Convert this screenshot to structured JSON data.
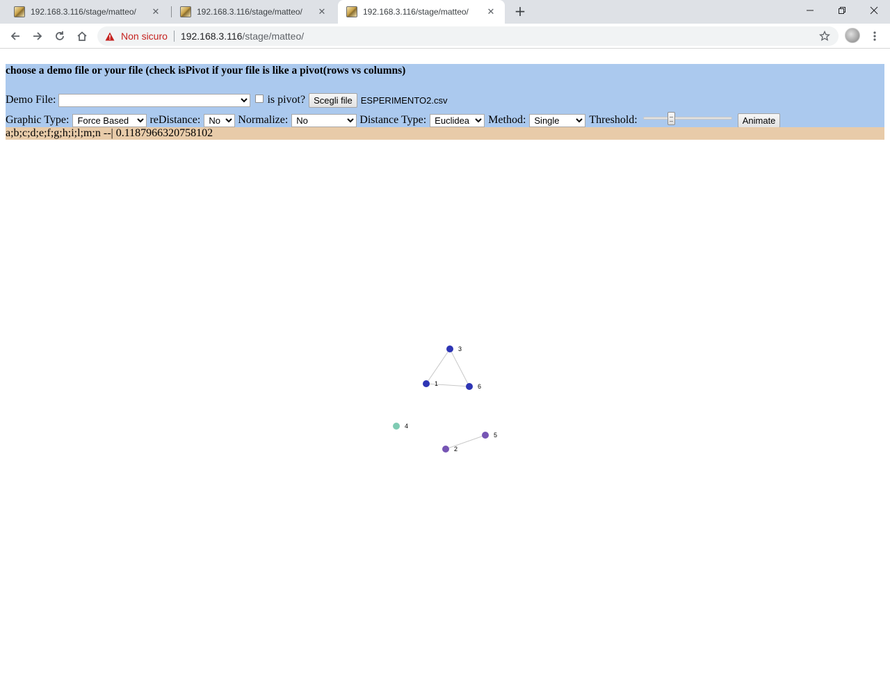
{
  "browser": {
    "tabs": [
      {
        "title": "192.168.3.116/stage/matteo/",
        "active": false
      },
      {
        "title": "192.168.3.116/stage/matteo/",
        "active": false
      },
      {
        "title": "192.168.3.116/stage/matteo/",
        "active": true
      }
    ],
    "security_text": "Non sicuro",
    "url_host": "192.168.3.116",
    "url_path": "/stage/matteo/",
    "icons": {
      "favicon": "image-favicon-icon",
      "close": "close-icon",
      "new_tab": "plus-icon",
      "back": "arrow-left-icon",
      "forward": "arrow-right-icon",
      "reload": "reload-icon",
      "home": "home-icon",
      "warning": "warning-triangle-icon",
      "bookmark": "star-icon",
      "menu": "kebab-menu-icon"
    }
  },
  "page": {
    "heading": "choose a demo file or your file (check isPivot if your file is like a pivot(rows vs columns)",
    "demo_file_label": "Demo File:",
    "demo_file_value": "",
    "is_pivot_label": "is pivot?",
    "is_pivot_checked": false,
    "choose_file_button": "Scegli file",
    "chosen_file_name": "ESPERIMENTO2.csv",
    "graphic_type_label": "Graphic Type:",
    "graphic_type_value": "Force Based",
    "redistance_label": "reDistance:",
    "redistance_value": "No",
    "normalize_label": "Normalize:",
    "normalize_value": "No",
    "distance_type_label": "Distance Type:",
    "distance_type_value": "Euclidea",
    "method_label": "Method:",
    "method_value": "Single",
    "threshold_label": "Threshold:",
    "threshold_level": 0.3,
    "animate_button": "Animate",
    "result_text": "a;b;c;d;e;f;g;h;i;l;m;n --| 0.1187966320758102",
    "colors": {
      "panel_bg": "#abc9ee",
      "result_bg": "#e8cba9"
    }
  },
  "graph": {
    "nodes": [
      {
        "id": "3",
        "color": "#2e35b4"
      },
      {
        "id": "1",
        "color": "#2e35b4"
      },
      {
        "id": "6",
        "color": "#2e35b4"
      },
      {
        "id": "4",
        "color": "#7fcbb3"
      },
      {
        "id": "5",
        "color": "#7655b4"
      },
      {
        "id": "2",
        "color": "#7655b4"
      }
    ],
    "links": [
      {
        "source": "3",
        "target": "1"
      },
      {
        "source": "3",
        "target": "6"
      },
      {
        "source": "1",
        "target": "6"
      },
      {
        "source": "5",
        "target": "2"
      }
    ]
  }
}
